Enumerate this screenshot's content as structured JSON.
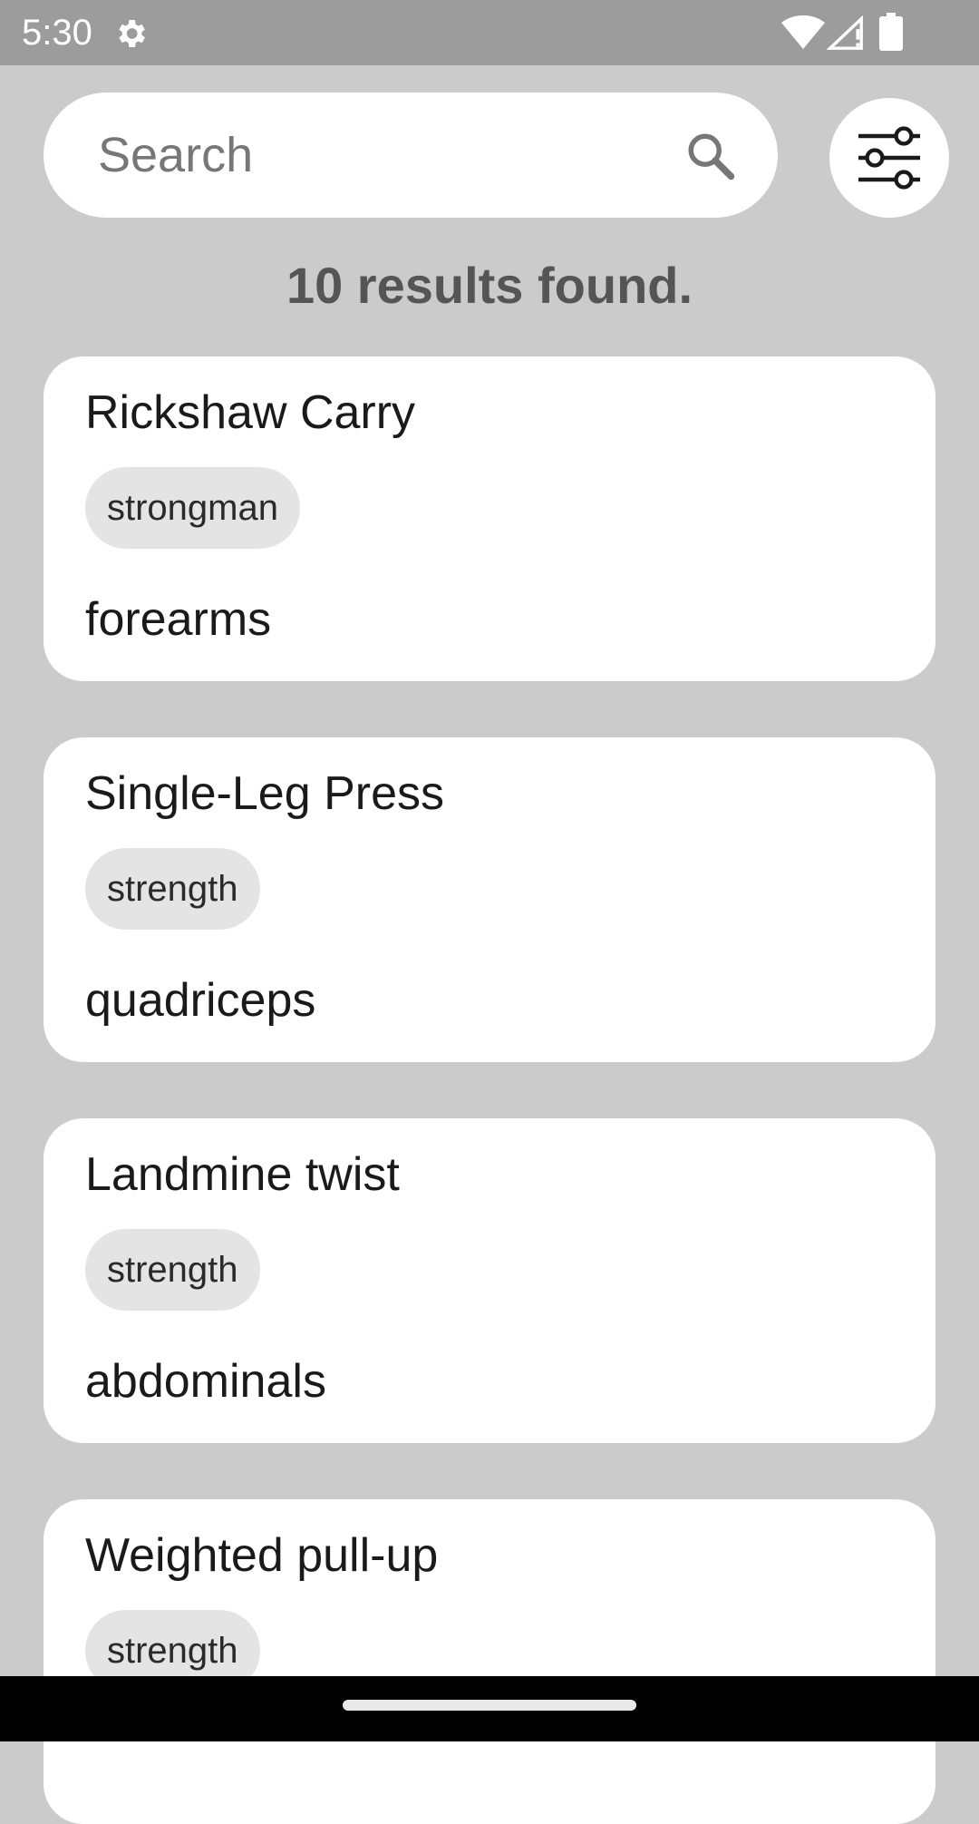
{
  "status_bar": {
    "time": "5:30",
    "icons": [
      "gear-icon",
      "wifi-icon",
      "signal-icon",
      "battery-icon"
    ]
  },
  "search": {
    "placeholder": "Search",
    "value": "",
    "icon": "search-icon"
  },
  "filter": {
    "icon": "sliders-icon"
  },
  "results": {
    "summary": "10 results found."
  },
  "exercises": [
    {
      "name": "Rickshaw Carry",
      "category": "strongman",
      "muscle": "forearms"
    },
    {
      "name": "Single-Leg Press",
      "category": "strength",
      "muscle": "quadriceps"
    },
    {
      "name": "Landmine twist",
      "category": "strength",
      "muscle": "abdominals"
    },
    {
      "name": "Weighted pull-up",
      "category": "strength",
      "muscle": ""
    }
  ],
  "colors": {
    "background": "#cbcbcb",
    "status_bar": "#9c9c9c",
    "card": "#ffffff",
    "chip": "#e4e4e4"
  }
}
